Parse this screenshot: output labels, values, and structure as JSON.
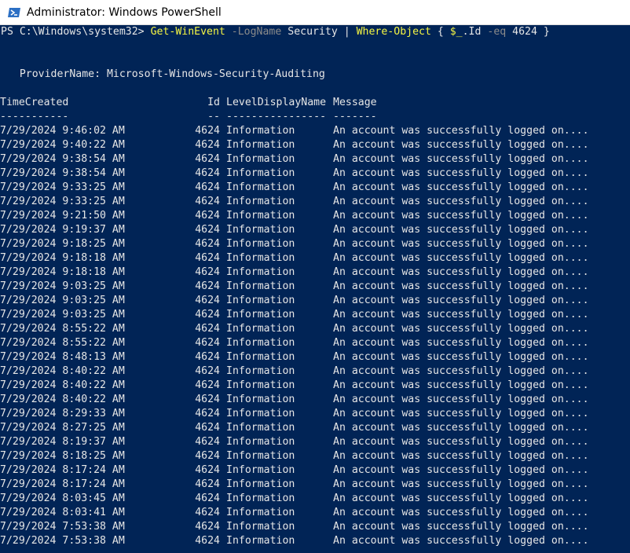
{
  "window": {
    "title": "Administrator: Windows PowerShell"
  },
  "colors": {
    "console_bg": "#012456",
    "title_bg": "#ffffff",
    "cmd_yellow": "#f5f543",
    "param_gray": "#8a8a8a",
    "text": "#e6e6e6"
  },
  "prompt": {
    "path": "PS C:\\Windows\\system32> ",
    "cmd1": "Get-WinEvent",
    "param1": " -LogName",
    "arg1": " Security ",
    "pipe": "|",
    "cmd2": " Where-Object",
    "brace_open": " { ",
    "var": "$_",
    "prop": ".Id",
    "param2": " -eq",
    "value": " 4624 }"
  },
  "provider_line": "   ProviderName: Microsoft-Windows-Security-Auditing",
  "table": {
    "headers": {
      "time": "TimeCreated",
      "id": "Id",
      "level": "LevelDisplayName",
      "message": "Message"
    },
    "underline": {
      "time": "-----------",
      "id": "--",
      "level": "----------------",
      "message": "-------"
    },
    "rows": [
      {
        "time": "7/29/2024 9:46:02 AM",
        "id": "4624",
        "level": "Information",
        "message": "An account was successfully logged on...."
      },
      {
        "time": "7/29/2024 9:40:22 AM",
        "id": "4624",
        "level": "Information",
        "message": "An account was successfully logged on...."
      },
      {
        "time": "7/29/2024 9:38:54 AM",
        "id": "4624",
        "level": "Information",
        "message": "An account was successfully logged on...."
      },
      {
        "time": "7/29/2024 9:38:54 AM",
        "id": "4624",
        "level": "Information",
        "message": "An account was successfully logged on...."
      },
      {
        "time": "7/29/2024 9:33:25 AM",
        "id": "4624",
        "level": "Information",
        "message": "An account was successfully logged on...."
      },
      {
        "time": "7/29/2024 9:33:25 AM",
        "id": "4624",
        "level": "Information",
        "message": "An account was successfully logged on...."
      },
      {
        "time": "7/29/2024 9:21:50 AM",
        "id": "4624",
        "level": "Information",
        "message": "An account was successfully logged on...."
      },
      {
        "time": "7/29/2024 9:19:37 AM",
        "id": "4624",
        "level": "Information",
        "message": "An account was successfully logged on...."
      },
      {
        "time": "7/29/2024 9:18:25 AM",
        "id": "4624",
        "level": "Information",
        "message": "An account was successfully logged on...."
      },
      {
        "time": "7/29/2024 9:18:18 AM",
        "id": "4624",
        "level": "Information",
        "message": "An account was successfully logged on...."
      },
      {
        "time": "7/29/2024 9:18:18 AM",
        "id": "4624",
        "level": "Information",
        "message": "An account was successfully logged on...."
      },
      {
        "time": "7/29/2024 9:03:25 AM",
        "id": "4624",
        "level": "Information",
        "message": "An account was successfully logged on...."
      },
      {
        "time": "7/29/2024 9:03:25 AM",
        "id": "4624",
        "level": "Information",
        "message": "An account was successfully logged on...."
      },
      {
        "time": "7/29/2024 9:03:25 AM",
        "id": "4624",
        "level": "Information",
        "message": "An account was successfully logged on...."
      },
      {
        "time": "7/29/2024 8:55:22 AM",
        "id": "4624",
        "level": "Information",
        "message": "An account was successfully logged on...."
      },
      {
        "time": "7/29/2024 8:55:22 AM",
        "id": "4624",
        "level": "Information",
        "message": "An account was successfully logged on...."
      },
      {
        "time": "7/29/2024 8:48:13 AM",
        "id": "4624",
        "level": "Information",
        "message": "An account was successfully logged on...."
      },
      {
        "time": "7/29/2024 8:40:22 AM",
        "id": "4624",
        "level": "Information",
        "message": "An account was successfully logged on...."
      },
      {
        "time": "7/29/2024 8:40:22 AM",
        "id": "4624",
        "level": "Information",
        "message": "An account was successfully logged on...."
      },
      {
        "time": "7/29/2024 8:40:22 AM",
        "id": "4624",
        "level": "Information",
        "message": "An account was successfully logged on...."
      },
      {
        "time": "7/29/2024 8:29:33 AM",
        "id": "4624",
        "level": "Information",
        "message": "An account was successfully logged on...."
      },
      {
        "time": "7/29/2024 8:27:25 AM",
        "id": "4624",
        "level": "Information",
        "message": "An account was successfully logged on...."
      },
      {
        "time": "7/29/2024 8:19:37 AM",
        "id": "4624",
        "level": "Information",
        "message": "An account was successfully logged on...."
      },
      {
        "time": "7/29/2024 8:18:25 AM",
        "id": "4624",
        "level": "Information",
        "message": "An account was successfully logged on...."
      },
      {
        "time": "7/29/2024 8:17:24 AM",
        "id": "4624",
        "level": "Information",
        "message": "An account was successfully logged on...."
      },
      {
        "time": "7/29/2024 8:17:24 AM",
        "id": "4624",
        "level": "Information",
        "message": "An account was successfully logged on...."
      },
      {
        "time": "7/29/2024 8:03:45 AM",
        "id": "4624",
        "level": "Information",
        "message": "An account was successfully logged on...."
      },
      {
        "time": "7/29/2024 8:03:41 AM",
        "id": "4624",
        "level": "Information",
        "message": "An account was successfully logged on...."
      },
      {
        "time": "7/29/2024 7:53:38 AM",
        "id": "4624",
        "level": "Information",
        "message": "An account was successfully logged on...."
      },
      {
        "time": "7/29/2024 7:53:38 AM",
        "id": "4624",
        "level": "Information",
        "message": "An account was successfully logged on...."
      }
    ]
  }
}
